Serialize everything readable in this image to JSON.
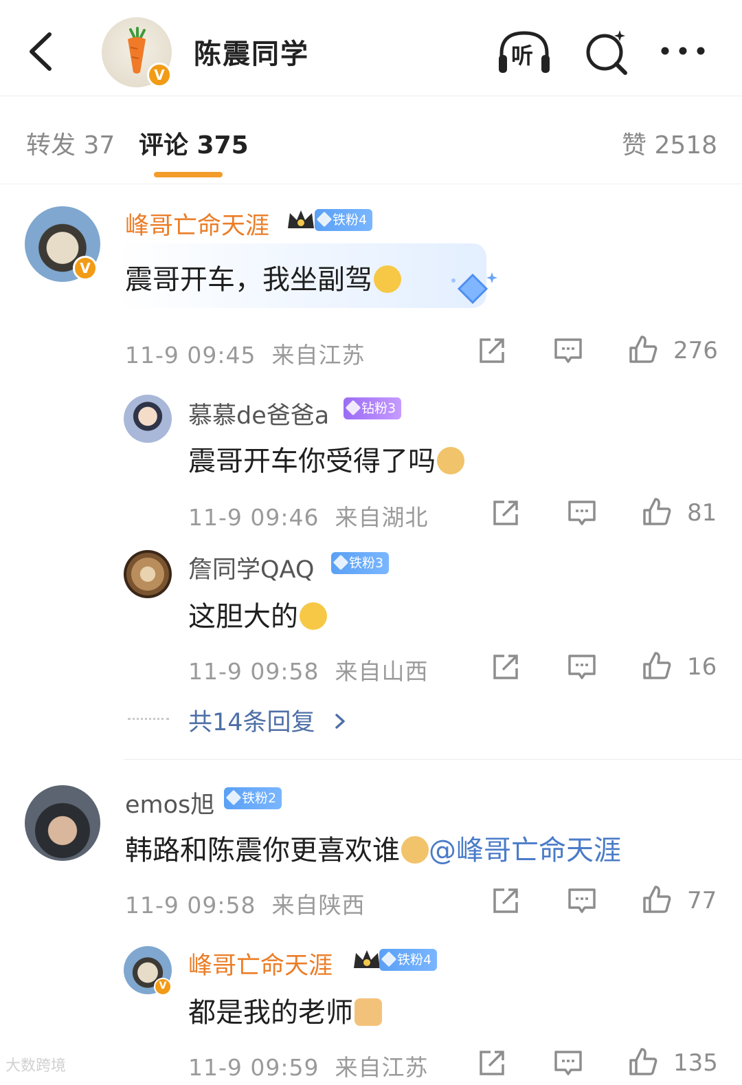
{
  "header": {
    "title": "陈震同学",
    "listen_label": "听",
    "avatar_badge": "V"
  },
  "tabs": {
    "repost": "转发 37",
    "comments": "评论 375",
    "likes": "赞 2518"
  },
  "comments": [
    {
      "user": "峰哥亡命天涯",
      "badge": "铁粉4",
      "text": "震哥开车，我坐副驾",
      "time": "11-9 09:45",
      "location": "来自江苏",
      "likes": "276",
      "verified_badge": "V"
    },
    {
      "user": "慕慕de爸爸a",
      "badge": "钻粉3",
      "text": "震哥开车你受得了吗",
      "time": "11-9 09:46",
      "location": "来自湖北",
      "likes": "81"
    },
    {
      "user": "詹同学QAQ",
      "badge": "铁粉3",
      "text": "这胆大的",
      "time": "11-9 09:58",
      "location": "来自山西",
      "likes": "16"
    },
    {
      "user": "emos旭",
      "badge": "铁粉2",
      "text": "韩路和陈震你更喜欢谁",
      "mention": "@峰哥亡命天涯",
      "time": "11-9 09:58",
      "location": "来自陕西",
      "likes": "77"
    },
    {
      "user": "峰哥亡命天涯",
      "badge": "铁粉4",
      "text": "都是我的老师",
      "time": "11-9 09:59",
      "location": "来自江苏",
      "likes": "135",
      "verified_badge": "V"
    }
  ],
  "more_replies": "共14条回复",
  "watermark": "大数跨境",
  "colors": {
    "accent": "#f39c2a",
    "username_orange": "#eb7d27",
    "mention_blue": "#4a7bc8",
    "iron_fan": "#5aa0f5",
    "diamond_fan": "#9b6cf5",
    "verified": "#f29b16"
  },
  "icons": [
    "back-icon",
    "listen-icon",
    "search-icon",
    "more-icon",
    "share-icon",
    "reply-icon",
    "like-icon"
  ]
}
